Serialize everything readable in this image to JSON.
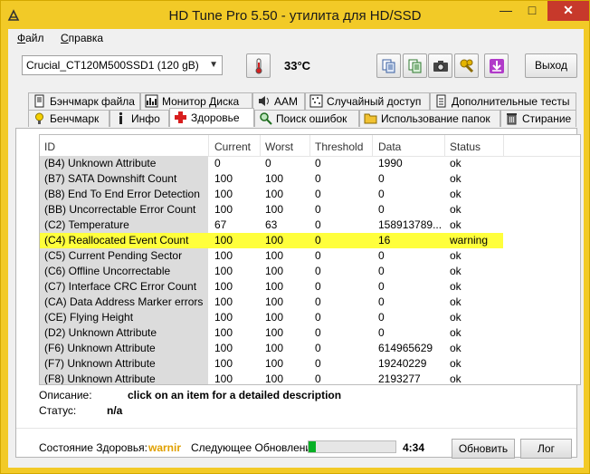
{
  "window": {
    "title": "HD Tune Pro 5.50 - утилита для HD/SSD",
    "minimize": "—",
    "maximize": "□",
    "close": "✕"
  },
  "menu": {
    "file_first": "Ф",
    "file_rest": "айл",
    "help_first": "С",
    "help_rest": "правка"
  },
  "toolbar": {
    "drive": "Crucial_CT120M500SSD1 (120 gB)",
    "temperature": "33°C",
    "exit_label": "Выход"
  },
  "tabs_top": [
    {
      "label": "Бэнчмарк файла",
      "icon": "file-benchmark-icon"
    },
    {
      "label": "Монитор Диска",
      "icon": "disk-monitor-icon"
    },
    {
      "label": "AAM",
      "icon": "speaker-icon"
    },
    {
      "label": "Случайный доступ",
      "icon": "random-access-icon"
    },
    {
      "label": "Дополнительные  тесты",
      "icon": "extra-tests-icon"
    }
  ],
  "tabs_bottom": [
    {
      "label": "Бенчмарк",
      "icon": "benchmark-icon"
    },
    {
      "label": "Инфо",
      "icon": "info-icon"
    },
    {
      "label": "Здоровье",
      "icon": "health-cross-icon"
    },
    {
      "label": "Поиск ошибок",
      "icon": "magnifier-icon"
    },
    {
      "label": "Использование папок",
      "icon": "folder-icon"
    },
    {
      "label": "Стирание",
      "icon": "trash-icon"
    }
  ],
  "table": {
    "headers": [
      "ID",
      "Current",
      "Worst",
      "Threshold",
      "Data",
      "Status"
    ],
    "rows": [
      [
        "(B4) Unknown Attribute",
        "0",
        "0",
        "0",
        "1990",
        "ok"
      ],
      [
        "(B7) SATA Downshift Count",
        "100",
        "100",
        "0",
        "0",
        "ok"
      ],
      [
        "(B8) End To End Error Detection",
        "100",
        "100",
        "0",
        "0",
        "ok"
      ],
      [
        "(BB) Uncorrectable Error Count",
        "100",
        "100",
        "0",
        "0",
        "ok"
      ],
      [
        "(C2) Temperature",
        "67",
        "63",
        "0",
        "158913789...",
        "ok"
      ],
      [
        "(C4) Reallocated Event Count",
        "100",
        "100",
        "0",
        "16",
        "warning"
      ],
      [
        "(C5) Current Pending Sector",
        "100",
        "100",
        "0",
        "0",
        "ok"
      ],
      [
        "(C6) Offline Uncorrectable",
        "100",
        "100",
        "0",
        "0",
        "ok"
      ],
      [
        "(C7) Interface CRC Error Count",
        "100",
        "100",
        "0",
        "0",
        "ok"
      ],
      [
        "(CA) Data Address Marker errors",
        "100",
        "100",
        "0",
        "0",
        "ok"
      ],
      [
        "(CE) Flying Height",
        "100",
        "100",
        "0",
        "0",
        "ok"
      ],
      [
        "(D2) Unknown Attribute",
        "100",
        "100",
        "0",
        "0",
        "ok"
      ],
      [
        "(F6) Unknown Attribute",
        "100",
        "100",
        "0",
        "614965629",
        "ok"
      ],
      [
        "(F7) Unknown Attribute",
        "100",
        "100",
        "0",
        "19240229",
        "ok"
      ],
      [
        "(F8) Unknown Attribute",
        "100",
        "100",
        "0",
        "2193277",
        "ok"
      ]
    ]
  },
  "details": {
    "description_label": "Описание:",
    "description_value": "click on an item for a detailed description",
    "status_label": "Статус:",
    "status_value": "n/a"
  },
  "footer": {
    "health_label": "Состояние Здоровья:",
    "health_value": "warnir",
    "next_update_label": "Следующее Обновление:",
    "progress_fraction": 0.08,
    "time_value": "4:34",
    "refresh_label": "Обновить",
    "log_label": "Лог"
  },
  "colors": {
    "frame": "#f2ca27",
    "warning_highlight": "#ffff3c",
    "health_warning": "#e0a000",
    "progress_fill": "#06b025"
  }
}
